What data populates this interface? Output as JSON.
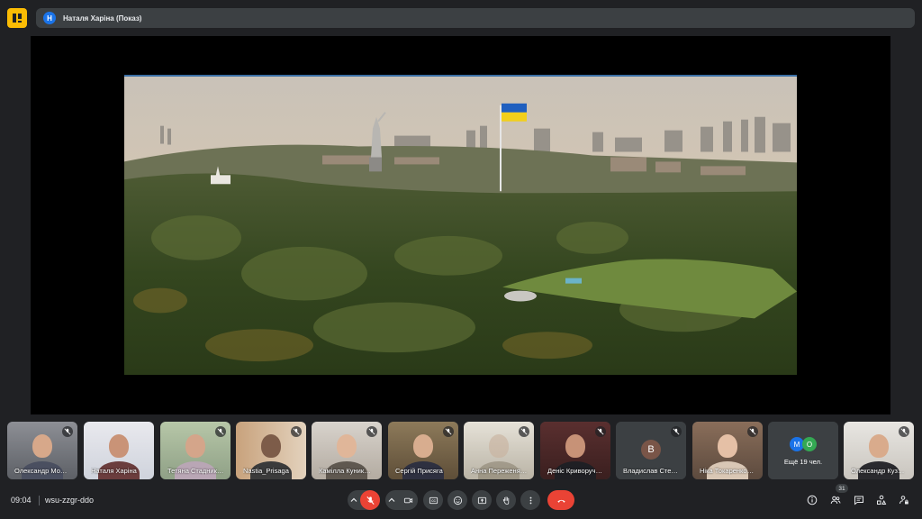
{
  "header": {
    "presenter_initial": "Н",
    "presenter_label": "Наталя Харіна (Показ)"
  },
  "participants": [
    {
      "name": "Олександр Мо…",
      "muted": true
    },
    {
      "name": "Наталя Харіна",
      "muted": false
    },
    {
      "name": "Тетяна Стадник…",
      "muted": true
    },
    {
      "name": "Nastia_Prisaga",
      "muted": true
    },
    {
      "name": "Камілла Куник…",
      "muted": true
    },
    {
      "name": "Сергій Присяга",
      "muted": true
    },
    {
      "name": "Анна Переженя…",
      "muted": true
    },
    {
      "name": "Деніс Криворучко…",
      "muted": true
    },
    {
      "name": "Владислав Сте…",
      "muted": true,
      "initial": "В"
    },
    {
      "name": "Ніка Токаренко…",
      "muted": true
    },
    {
      "name": "Олександр Куз…",
      "muted": true
    }
  ],
  "more_tile": {
    "initials": [
      "М",
      "О"
    ],
    "label": "Ещё 19 чел."
  },
  "footer": {
    "time": "09:04",
    "meeting_code": "wsu-zzgr-ddo",
    "participants_count": "31"
  },
  "colors": {
    "end_call": "#ea4335",
    "mic_off": "#ea4335",
    "logo": "#fbbc04"
  }
}
